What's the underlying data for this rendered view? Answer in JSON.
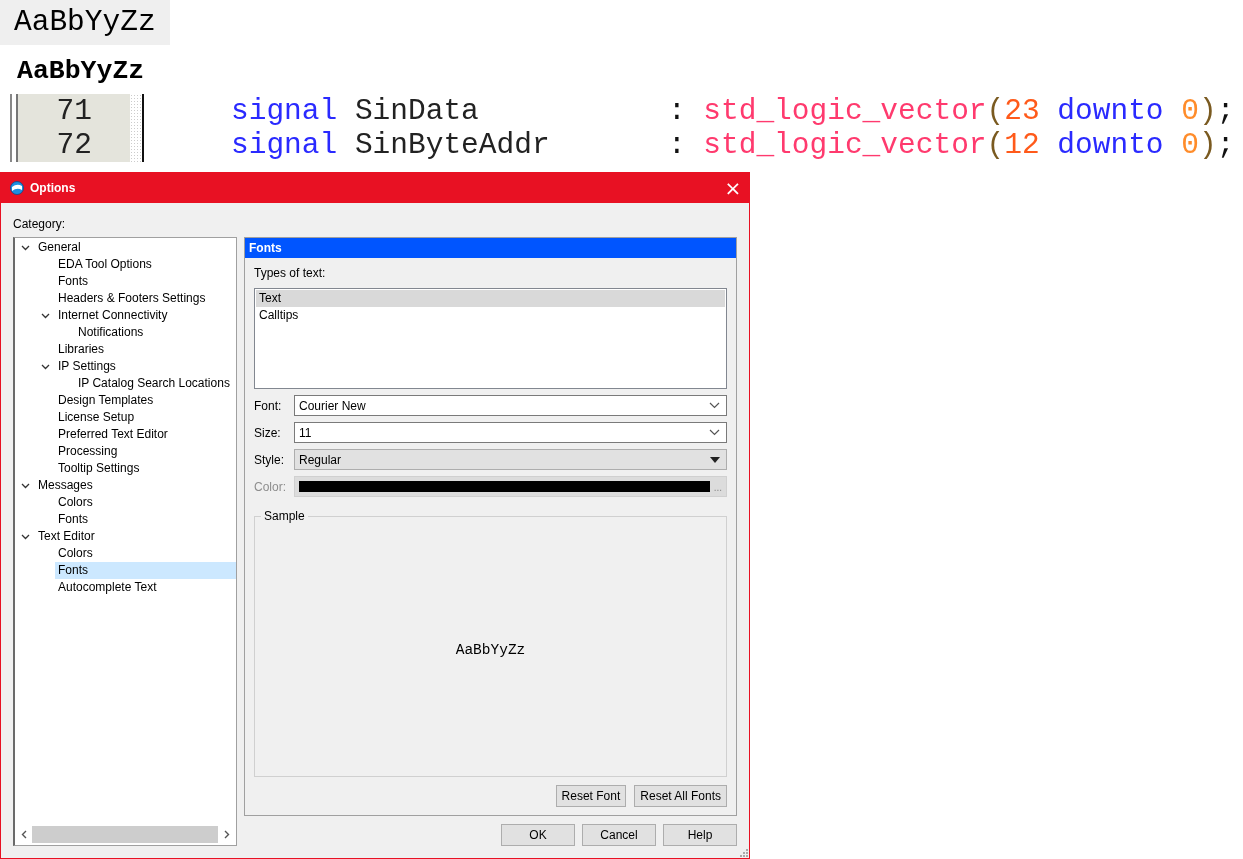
{
  "font_samples": [
    {
      "text": "AaBbYyZz",
      "kind": "shaded"
    },
    {
      "text": "AaBbYyZz",
      "kind": "bold"
    }
  ],
  "code_editor": {
    "lines": [
      {
        "number": "71",
        "tokens": [
          {
            "text": "signal",
            "kind": "keyword"
          },
          {
            "text": "SinData",
            "kind": "name"
          },
          {
            "text": ":",
            "kind": "colon"
          },
          {
            "text": "std_logic_vector",
            "kind": "type"
          },
          {
            "text": "(",
            "kind": "paren"
          },
          {
            "text": "23",
            "kind": "number"
          },
          {
            "text": "downto",
            "kind": "keyword"
          },
          {
            "text": "0",
            "kind": "literal"
          },
          {
            "text": ")",
            "kind": "paren"
          },
          {
            "text": ";",
            "kind": "semicolon"
          }
        ]
      },
      {
        "number": "72",
        "tokens": [
          {
            "text": "signal",
            "kind": "keyword"
          },
          {
            "text": "SinByteAddr",
            "kind": "name"
          },
          {
            "text": ":",
            "kind": "colon"
          },
          {
            "text": "std_logic_vector",
            "kind": "type"
          },
          {
            "text": "(",
            "kind": "paren"
          },
          {
            "text": "12",
            "kind": "number"
          },
          {
            "text": "downto",
            "kind": "keyword"
          },
          {
            "text": "0",
            "kind": "literal"
          },
          {
            "text": ")",
            "kind": "paren"
          },
          {
            "text": ";",
            "kind": "semicolon"
          }
        ]
      }
    ]
  },
  "window": {
    "title": "Options",
    "close": "×"
  },
  "category_label": "Category:",
  "tree": [
    {
      "label": "General",
      "expanded": true,
      "selected": false,
      "children": [
        {
          "label": "EDA Tool Options",
          "selected": false
        },
        {
          "label": "Fonts",
          "selected": false
        },
        {
          "label": "Headers & Footers Settings",
          "selected": false
        },
        {
          "label": "Internet Connectivity",
          "expanded": true,
          "selected": false,
          "children": [
            {
              "label": "Notifications",
              "selected": false
            }
          ]
        },
        {
          "label": "Libraries",
          "selected": false
        },
        {
          "label": "IP Settings",
          "expanded": true,
          "selected": false,
          "children": [
            {
              "label": "IP Catalog Search Locations",
              "selected": false
            }
          ]
        },
        {
          "label": "Design Templates",
          "selected": false
        },
        {
          "label": "License Setup",
          "selected": false
        },
        {
          "label": "Preferred Text Editor",
          "selected": false
        },
        {
          "label": "Processing",
          "selected": false
        },
        {
          "label": "Tooltip Settings",
          "selected": false
        }
      ]
    },
    {
      "label": "Messages",
      "expanded": true,
      "selected": false,
      "children": [
        {
          "label": "Colors",
          "selected": false
        },
        {
          "label": "Fonts",
          "selected": false
        }
      ]
    },
    {
      "label": "Text Editor",
      "expanded": true,
      "selected": false,
      "children": [
        {
          "label": "Colors",
          "selected": false
        },
        {
          "label": "Fonts",
          "selected": true
        },
        {
          "label": "Autocomplete Text",
          "selected": false
        }
      ]
    }
  ],
  "panel": {
    "title": "Fonts",
    "types_label": "Types of text:",
    "types": [
      {
        "label": "Text",
        "selected": true
      },
      {
        "label": "Calltips",
        "selected": false
      }
    ],
    "fields": [
      {
        "kind": "combo",
        "label": "Font:",
        "value": "Courier New",
        "disabled": false
      },
      {
        "kind": "combo",
        "label": "Size:",
        "value": "11",
        "disabled": false
      },
      {
        "kind": "choice",
        "label": "Style:",
        "value": "Regular",
        "disabled": false
      },
      {
        "kind": "color",
        "label": "Color:",
        "color": "#000000",
        "button": "...",
        "disabled": true
      }
    ],
    "sample": {
      "title": "Sample",
      "text": "AaBbYyZz"
    },
    "buttons": [
      "Reset Font",
      "Reset All Fonts"
    ]
  },
  "buttons": [
    "OK",
    "Cancel",
    "Help"
  ]
}
